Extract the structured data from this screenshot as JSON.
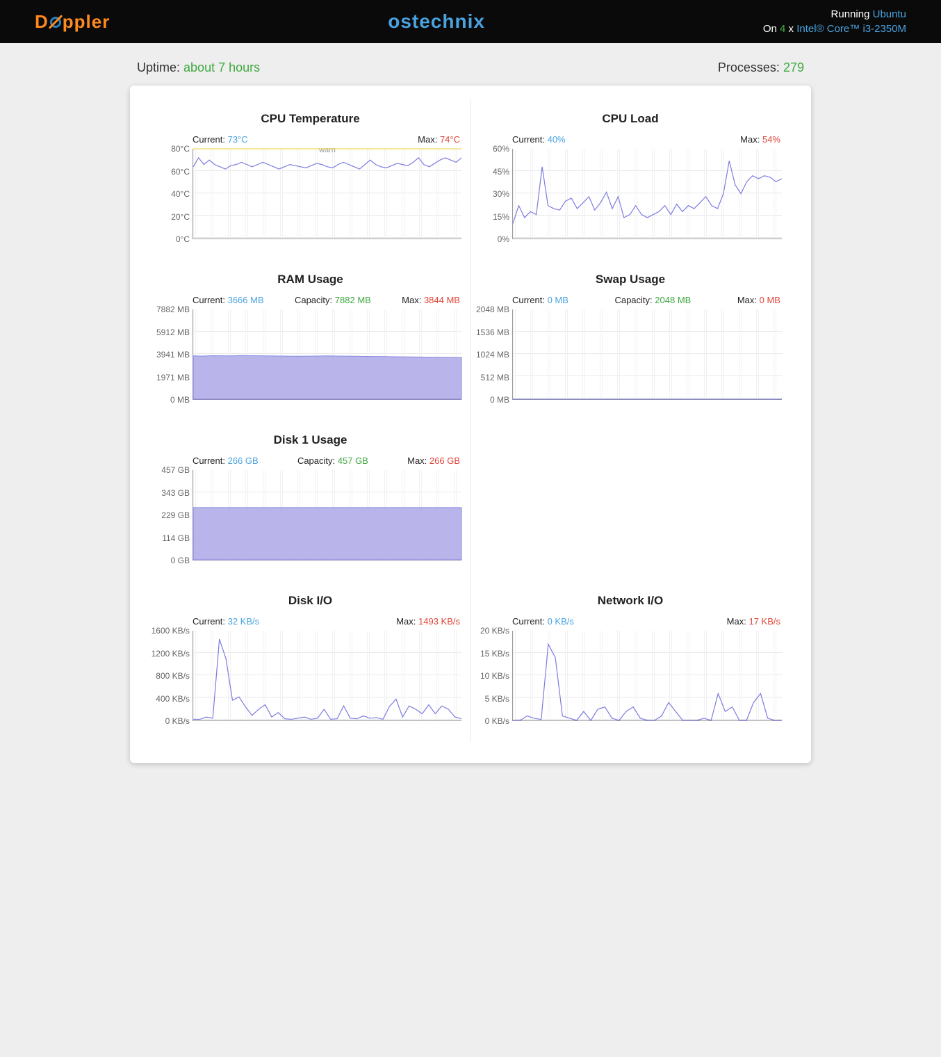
{
  "header": {
    "brand": "Doppler",
    "hostname": "ostechnix",
    "running_label": "Running",
    "os": "Ubuntu",
    "on_label": "On",
    "cores": "4",
    "times": "x",
    "cpu_model": "Intel® Core™ i3-2350M"
  },
  "meta": {
    "uptime_label": "Uptime:",
    "uptime_value": "about 7 hours",
    "processes_label": "Processes:",
    "processes_value": "279"
  },
  "panels": {
    "cpu_temp": {
      "title": "CPU Temperature",
      "current_label": "Current:",
      "current_value": "73°C",
      "max_label": "Max:",
      "max_value": "74°C",
      "warn_label": "warn",
      "ticks": [
        "80°C",
        "60°C",
        "40°C",
        "20°C",
        "0°C"
      ]
    },
    "cpu_load": {
      "title": "CPU Load",
      "current_label": "Current:",
      "current_value": "40%",
      "max_label": "Max:",
      "max_value": "54%",
      "ticks": [
        "60%",
        "45%",
        "30%",
        "15%",
        "0%"
      ]
    },
    "ram": {
      "title": "RAM Usage",
      "current_label": "Current:",
      "current_value": "3666 MB",
      "capacity_label": "Capacity:",
      "capacity_value": "7882 MB",
      "max_label": "Max:",
      "max_value": "3844 MB",
      "ticks": [
        "7882 MB",
        "5912 MB",
        "3941 MB",
        "1971 MB",
        "0 MB"
      ]
    },
    "swap": {
      "title": "Swap Usage",
      "current_label": "Current:",
      "current_value": "0 MB",
      "capacity_label": "Capacity:",
      "capacity_value": "2048 MB",
      "max_label": "Max:",
      "max_value": "0 MB",
      "ticks": [
        "2048 MB",
        "1536 MB",
        "1024 MB",
        "512 MB",
        "0 MB"
      ]
    },
    "disk1": {
      "title": "Disk 1 Usage",
      "current_label": "Current:",
      "current_value": "266 GB",
      "capacity_label": "Capacity:",
      "capacity_value": "457 GB",
      "max_label": "Max:",
      "max_value": "266 GB",
      "ticks": [
        "457 GB",
        "343 GB",
        "229 GB",
        "114 GB",
        "0 GB"
      ]
    },
    "diskio": {
      "title": "Disk I/O",
      "current_label": "Current:",
      "current_value": "32 KB/s",
      "max_label": "Max:",
      "max_value": "1493 KB/s",
      "ticks": [
        "1600 KB/s",
        "1200 KB/s",
        "800 KB/s",
        "400 KB/s",
        "0 KB/s"
      ]
    },
    "netio": {
      "title": "Network I/O",
      "current_label": "Current:",
      "current_value": "0 KB/s",
      "max_label": "Max:",
      "max_value": "17 KB/s",
      "ticks": [
        "20 KB/s",
        "15 KB/s",
        "10 KB/s",
        "5 KB/s",
        "0 KB/s"
      ]
    }
  },
  "chart_data": [
    {
      "id": "cpu_temp",
      "type": "line",
      "title": "CPU Temperature",
      "ylabel": "°C",
      "ylim": [
        0,
        80
      ],
      "warn": 80,
      "values": [
        64,
        72,
        66,
        70,
        66,
        64,
        62,
        65,
        66,
        68,
        66,
        64,
        66,
        68,
        66,
        64,
        62,
        64,
        66,
        65,
        64,
        63,
        65,
        67,
        66,
        64,
        63,
        66,
        68,
        66,
        64,
        62,
        66,
        70,
        66,
        64,
        63,
        65,
        67,
        66,
        65,
        68,
        72,
        66,
        64,
        67,
        70,
        72,
        70,
        68,
        72
      ]
    },
    {
      "id": "cpu_load",
      "type": "line",
      "title": "CPU Load",
      "ylabel": "%",
      "ylim": [
        0,
        60
      ],
      "values": [
        10,
        22,
        14,
        18,
        16,
        48,
        22,
        20,
        19,
        25,
        27,
        20,
        24,
        28,
        19,
        24,
        31,
        20,
        28,
        14,
        16,
        22,
        16,
        14,
        16,
        18,
        22,
        16,
        23,
        18,
        22,
        20,
        24,
        28,
        22,
        20,
        30,
        52,
        36,
        30,
        38,
        42,
        40,
        42,
        41,
        38,
        40
      ]
    },
    {
      "id": "ram",
      "type": "area",
      "title": "RAM Usage",
      "ylabel": "MB",
      "ylim": [
        0,
        7882
      ],
      "values": [
        3800,
        3790,
        3820,
        3810,
        3800,
        3830,
        3820,
        3810,
        3800,
        3790,
        3780,
        3770,
        3780,
        3790,
        3800,
        3790,
        3780,
        3770,
        3760,
        3750,
        3740,
        3730,
        3720,
        3710,
        3700,
        3690,
        3680,
        3670,
        3666
      ]
    },
    {
      "id": "swap",
      "type": "area",
      "title": "Swap Usage",
      "ylabel": "MB",
      "ylim": [
        0,
        2048
      ],
      "values": [
        0,
        0,
        0,
        0,
        0,
        0,
        0,
        0,
        0,
        0,
        0,
        0,
        0,
        0,
        0,
        0,
        0,
        0,
        0,
        0,
        0,
        0,
        0,
        0,
        0,
        0,
        0,
        0,
        0
      ]
    },
    {
      "id": "disk1",
      "type": "area",
      "title": "Disk 1 Usage",
      "ylabel": "GB",
      "ylim": [
        0,
        457
      ],
      "values": [
        266,
        266,
        266,
        266,
        266,
        266,
        266,
        266,
        266,
        266,
        266,
        266,
        266,
        266,
        266,
        266,
        266,
        266,
        266,
        266,
        266,
        266,
        266,
        266,
        266,
        266,
        266,
        266,
        266
      ]
    },
    {
      "id": "diskio",
      "type": "line",
      "title": "Disk I/O",
      "ylabel": "KB/s",
      "ylim": [
        0,
        1600
      ],
      "values": [
        20,
        20,
        60,
        40,
        1450,
        1100,
        360,
        420,
        240,
        90,
        200,
        280,
        60,
        140,
        30,
        20,
        40,
        60,
        20,
        40,
        200,
        20,
        30,
        260,
        40,
        30,
        80,
        40,
        50,
        20,
        250,
        380,
        60,
        260,
        200,
        120,
        280,
        120,
        260,
        200,
        60,
        32
      ]
    },
    {
      "id": "netio",
      "type": "line",
      "title": "Network I/O",
      "ylabel": "KB/s",
      "ylim": [
        0,
        20
      ],
      "values": [
        0,
        0,
        1,
        0.5,
        0.2,
        17,
        14,
        1,
        0.5,
        0,
        2,
        0,
        2.5,
        3,
        0.5,
        0,
        2,
        3,
        0.5,
        0,
        0,
        1,
        4,
        2,
        0,
        0,
        0,
        0.5,
        0,
        6,
        2,
        3,
        0,
        0,
        4,
        6,
        0.5,
        0,
        0
      ]
    }
  ]
}
